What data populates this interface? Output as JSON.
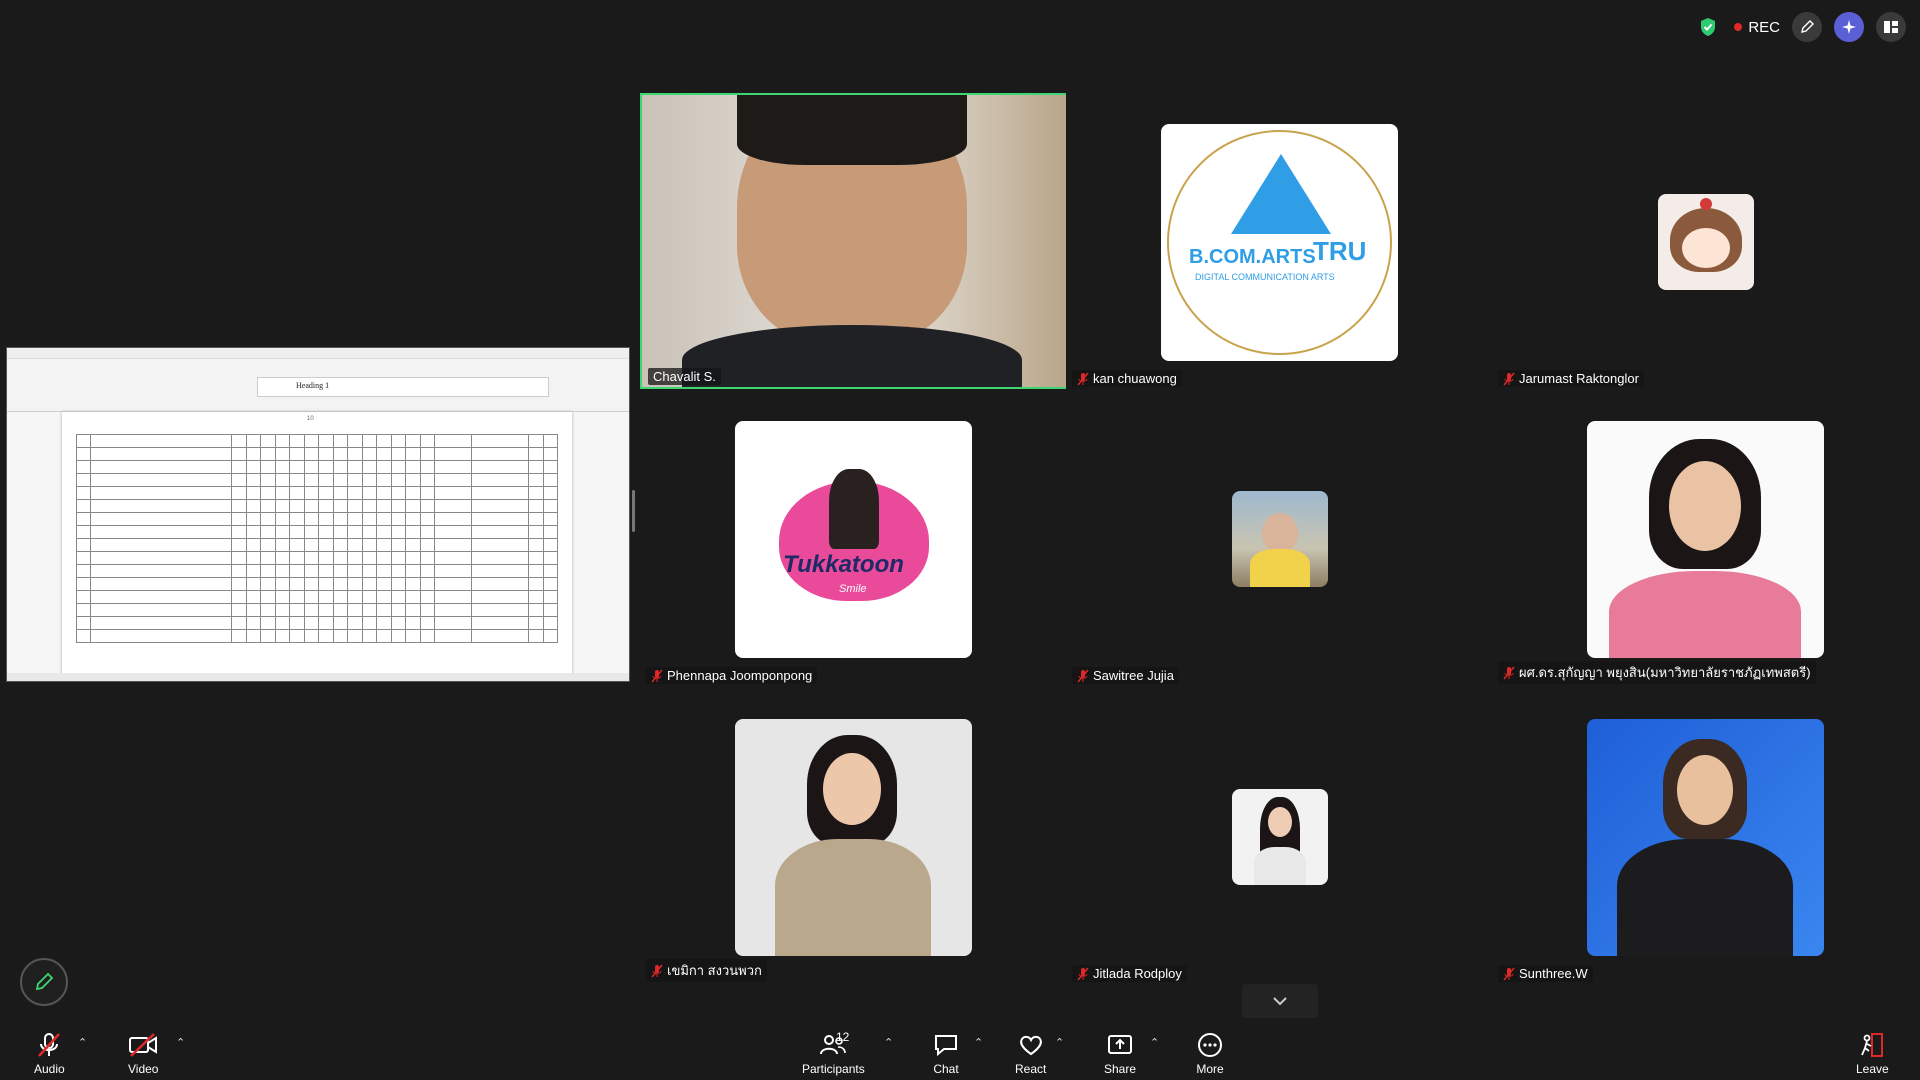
{
  "top_bar": {
    "rec_label": "REC"
  },
  "tiles": [
    {
      "name": "Chavalit S."
    },
    {
      "name": "kan chuawong",
      "logo_line1": "B.COM.ARTS",
      "logo_line2": "TRU",
      "logo_sub": "DIGITAL COMMUNICATION ARTS"
    },
    {
      "name": "Jarumast Raktonglor"
    },
    {
      "name": "Phennapa Joomponpong",
      "logo_text": "Tukkatoon",
      "logo_sub": "Smile"
    },
    {
      "name": "Sawitree Jujia"
    },
    {
      "name": "ผศ.ดร.สุกัญญา พยุงสิน(มหาวิทยาลัยราชภัฏเทพสตรี)"
    },
    {
      "name": "เขมิกา สงวนพวก"
    },
    {
      "name": "Jitlada Rodploy"
    },
    {
      "name": "Sunthree.W"
    }
  ],
  "shared_screen": {
    "heading_style": "Heading 1",
    "page_number": "10"
  },
  "toolbar": {
    "audio": "Audio",
    "video": "Video",
    "participants": "Participants",
    "participants_count": "12",
    "chat": "Chat",
    "react": "React",
    "share": "Share",
    "more": "More",
    "leave": "Leave"
  },
  "colors": {
    "active_speaker": "#3ed672",
    "mute": "#e02828",
    "background": "#1a1a1a"
  }
}
